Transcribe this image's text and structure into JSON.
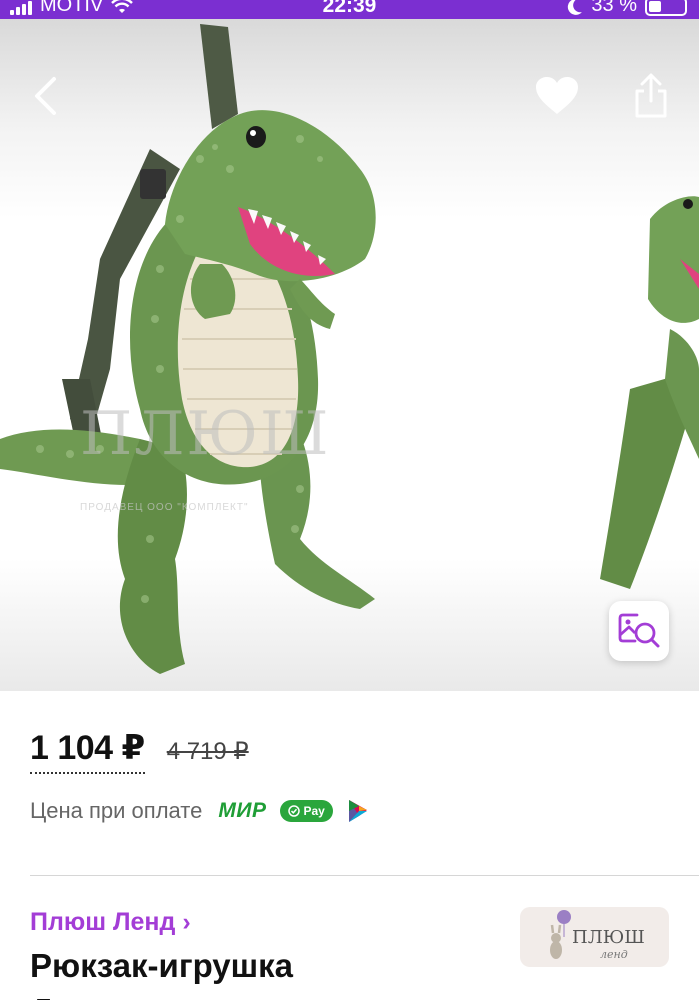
{
  "status_bar": {
    "carrier": "MOTIV",
    "time": "22:39",
    "battery": "33 %"
  },
  "gallery": {
    "watermark": "ПЛЮШ",
    "watermark_small": "ПРОДАВЕЦ ООО \"КОМПЛЕКТ\""
  },
  "price": {
    "current": "1 104 ₽",
    "old": "4 719 ₽",
    "pay_label": "Цена при оплате",
    "mir_label": "МИР",
    "gpay_label": "Pay"
  },
  "seller": {
    "name": "Плюш Ленд ›",
    "logo_text": "ПЛЮШ",
    "logo_subtext": "ленд"
  },
  "product": {
    "title_line1": "Рюкзак-игрушка",
    "title_line2": "Динозавр"
  },
  "colors": {
    "brand_purple": "#7b2fd1",
    "seller_link": "#a33dd6",
    "mir_green": "#1f9e36",
    "dino_green": "#6f9a52"
  }
}
